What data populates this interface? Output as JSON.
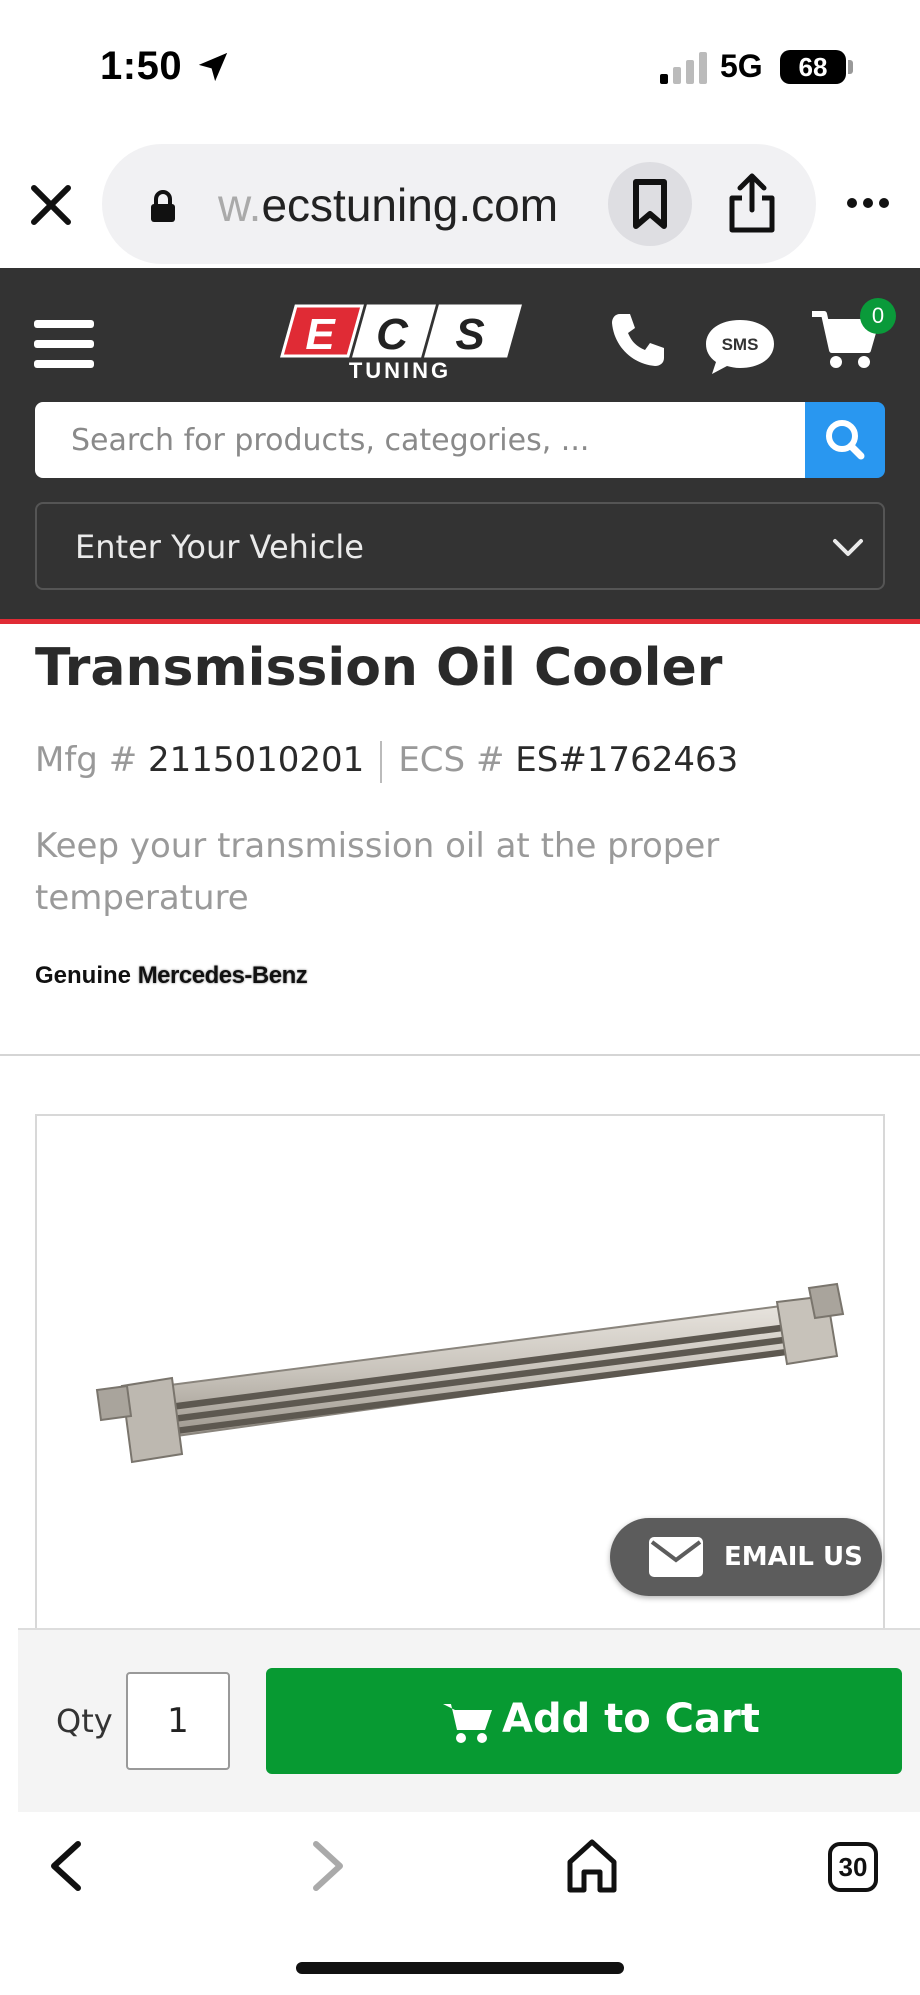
{
  "status_bar": {
    "time": "1:50",
    "network": "5G",
    "battery": "68"
  },
  "browser": {
    "url_prefix": "w.",
    "url_domain": "ecstuning.com"
  },
  "header": {
    "logo_text_top": "ECS",
    "logo_text_bottom": "TUNING",
    "sms_label": "SMS",
    "cart_count": "0",
    "search_placeholder": "Search for products, categories, ...",
    "vehicle_label": "Enter Your Vehicle"
  },
  "product": {
    "title": "Transmission Oil Cooler",
    "mfg_label": "Mfg #",
    "mfg_number": "2115010201",
    "ecs_label": "ECS #",
    "ecs_number": "ES#1762463",
    "description": "Keep your transmission oil at the proper temperature",
    "brand_prefix": "Genuine",
    "brand_name": "Mercedes-Benz"
  },
  "email_button": {
    "label": "EMAIL US"
  },
  "cart_bar": {
    "qty_label": "Qty",
    "qty_value": "1",
    "add_to_cart_label": "Add to Cart"
  },
  "bottom_toolbar": {
    "tab_count": "30"
  },
  "colors": {
    "header_bg": "#333333",
    "accent_red": "#e02b35",
    "search_blue": "#2997f0",
    "cart_green": "#079a32"
  },
  "icons": [
    "location-arrow-icon",
    "signal-icon",
    "battery-icon",
    "close-icon",
    "lock-icon",
    "bookmark-icon",
    "share-icon",
    "more-icon",
    "menu-icon",
    "phone-icon",
    "sms-icon",
    "cart-icon",
    "search-icon",
    "chevron-down-icon",
    "email-icon",
    "back-icon",
    "forward-icon",
    "home-icon",
    "tabs-icon"
  ]
}
